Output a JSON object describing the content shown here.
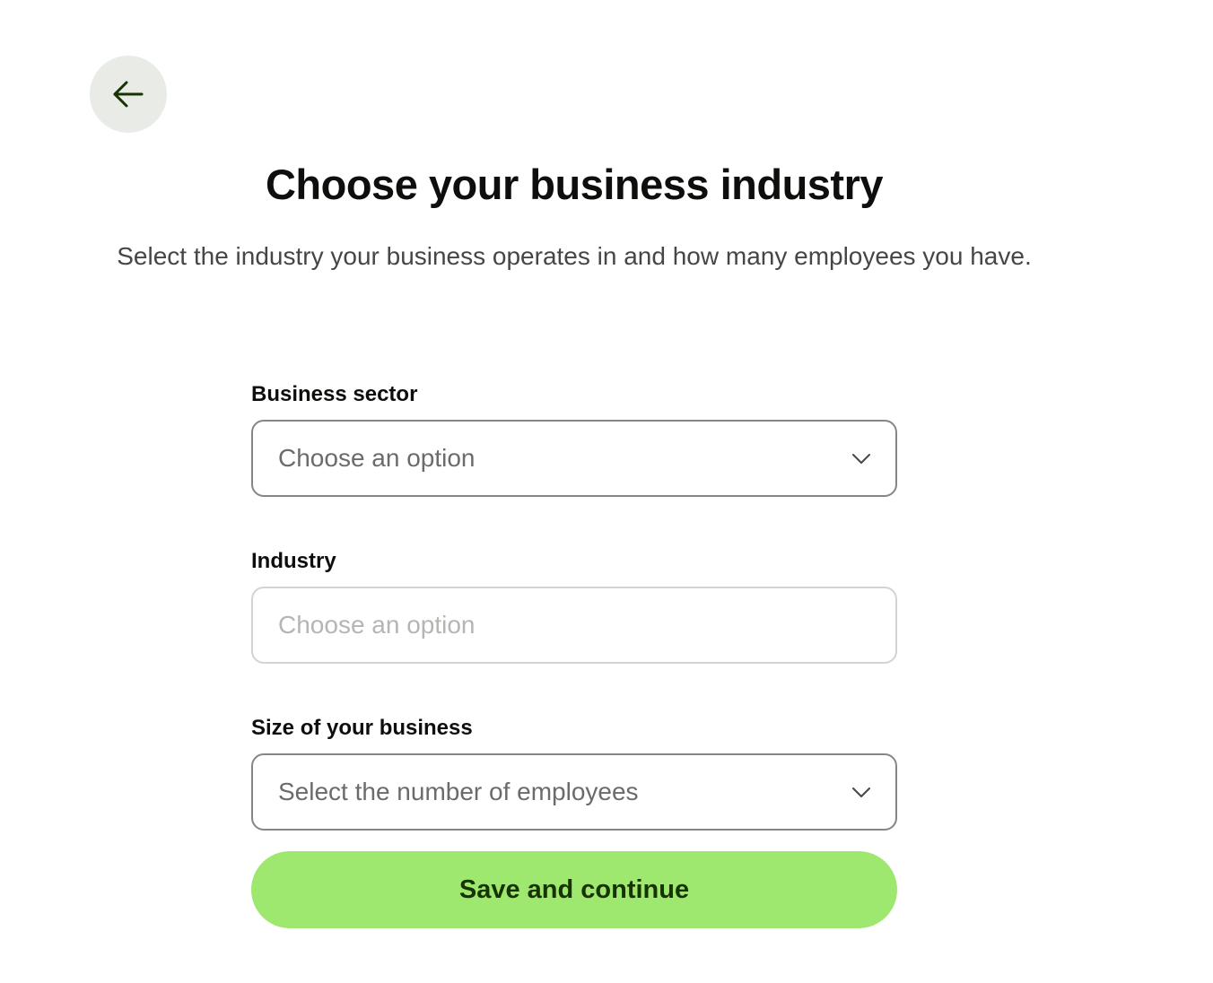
{
  "header": {
    "back_icon": "arrow-left-icon",
    "title": "Choose your business industry",
    "subtitle": "Select the industry your business operates in and how many employees you have."
  },
  "form": {
    "business_sector": {
      "label": "Business sector",
      "placeholder": "Choose an option",
      "icon": "chevron-down-icon"
    },
    "industry": {
      "label": "Industry",
      "placeholder": "Choose an option",
      "disabled": true
    },
    "size": {
      "label": "Size of your business",
      "placeholder": "Select the number of employees",
      "icon": "chevron-down-icon"
    }
  },
  "actions": {
    "save_label": "Save and continue"
  },
  "colors": {
    "accent": "#9fe870",
    "accent_text": "#163300",
    "back_button_bg": "#e8ebe6"
  }
}
